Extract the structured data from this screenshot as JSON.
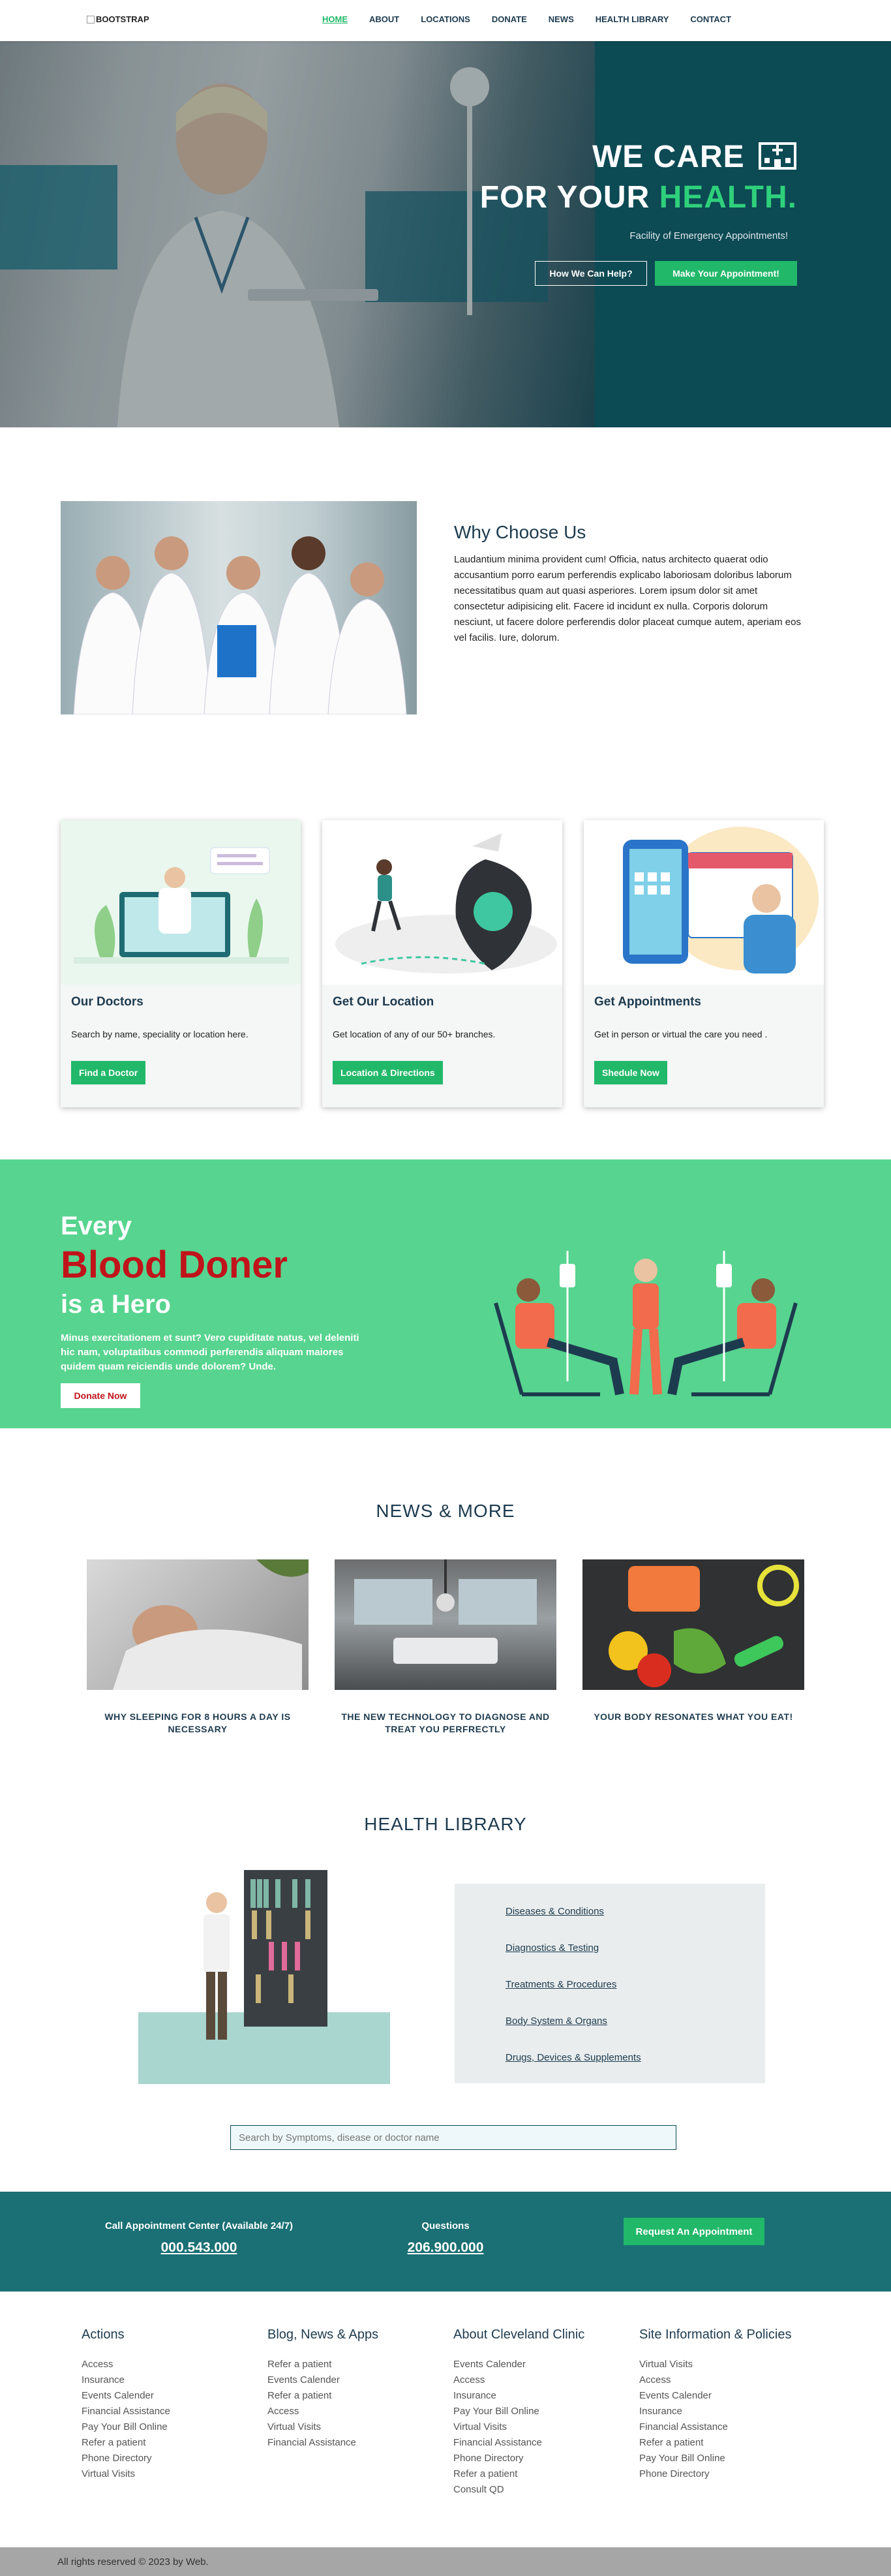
{
  "nav": {
    "logo": "BOOTSTRAP",
    "items": [
      {
        "label": "HOME",
        "active": true
      },
      {
        "label": "ABOUT"
      },
      {
        "label": "LOCATIONS"
      },
      {
        "label": "DONATE"
      },
      {
        "label": "NEWS"
      },
      {
        "label": "HEALTH LIBRARY"
      },
      {
        "label": "CONTACT"
      }
    ]
  },
  "hero": {
    "line1": "WE CARE",
    "line2_prefix": "FOR YOUR ",
    "line2_highlight": "HEALTH.",
    "subtitle": "Facility of Emergency Appointments!",
    "btn_help": "How We Can Help?",
    "btn_appointment": "Make Your Appointment!"
  },
  "why": {
    "title": "Why Choose Us",
    "text": "Laudantium minima provident cum! Officia, natus architecto quaerat odio accusantium porro earum perferendis explicabo laboriosam doloribus laborum necessitatibus quam aut quasi asperiores. Lorem ipsum dolor sit amet consectetur adipisicing elit. Facere id incidunt ex nulla. Corporis dolorum nesciunt, ut facere dolore perferendis dolor placeat cumque autem, aperiam eos vel facilis. Iure, dolorum."
  },
  "cards": [
    {
      "title": "Our Doctors",
      "desc": "Search by name, speciality or location here.",
      "button": "Find a Doctor"
    },
    {
      "title": "Get Our Location",
      "desc": "Get location of any of our 50+ branches.",
      "button": "Location & Directions"
    },
    {
      "title": "Get Appointments",
      "desc": "Get in person or virtual the care you need .",
      "button": "Shedule Now"
    }
  ],
  "blood": {
    "line1": "Every",
    "line2": "Blood Doner",
    "line3": "is a Hero",
    "text": "Minus exercitationem et sunt? Vero cupiditate natus, vel deleniti hic nam, voluptatibus commodi perferendis aliquam maiores quidem quam reiciendis unde dolorem? Unde.",
    "button": "Donate Now"
  },
  "news": {
    "title": "NEWS & MORE",
    "items": [
      {
        "caption": "WHY SLEEPING FOR 8 HOURS A DAY IS NECESSARY"
      },
      {
        "caption": "THE NEW TECHNOLOGY TO DIAGNOSE AND TREAT YOU PERFRECTLY"
      },
      {
        "caption": "YOUR BODY RESONATES WHAT YOU EAT!"
      }
    ]
  },
  "library": {
    "title": "HEALTH LIBRARY",
    "links": [
      "Diseases & Conditions",
      "Diagnostics & Testing",
      "Treatments & Procedures",
      "Body System & Organs",
      "Drugs, Devices & Supplements"
    ],
    "search_placeholder": "Search by Symptoms, disease or doctor name"
  },
  "cta": {
    "center_label": "Call Appointment Center (Available 24/7)",
    "center_phone": "000.543.000",
    "questions_label": "Questions",
    "questions_phone": "206.900.000",
    "button": "Request An Appointment"
  },
  "footer": {
    "columns": [
      {
        "title": "Actions",
        "links": [
          "Access",
          "Insurance",
          "Events Calender",
          "Financial Assistance",
          "Pay Your Bill Online",
          "Refer a patient",
          "Phone Directory",
          "Virtual Visits"
        ]
      },
      {
        "title": "Blog, News & Apps",
        "links": [
          "Refer a patient",
          "Events Calender",
          "Refer a patient",
          "Access",
          "Virtual Visits",
          "Financial Assistance"
        ]
      },
      {
        "title": "About Cleveland Clinic",
        "links": [
          "Events Calender",
          "Access",
          "Insurance",
          "Pay Your Bill Online",
          "Virtual Visits",
          "Financial Assistance",
          "Phone Directory",
          "Refer a patient",
          "Consult QD"
        ]
      },
      {
        "title": "Site Information & Policies",
        "links": [
          "Virtual Visits",
          "Access",
          "Events Calender",
          "Insurance",
          "Financial Assistance",
          "Refer a patient",
          "Pay Your Bill Online",
          "Phone Directory"
        ]
      }
    ],
    "copyright": "All rights reserved © 2023 by Web."
  },
  "colors": {
    "accent_green": "#22b86a",
    "dark_teal": "#0c4a54",
    "cta_teal": "#1a7074",
    "blood_bg": "#57d48f",
    "blood_red": "#c0131a"
  }
}
